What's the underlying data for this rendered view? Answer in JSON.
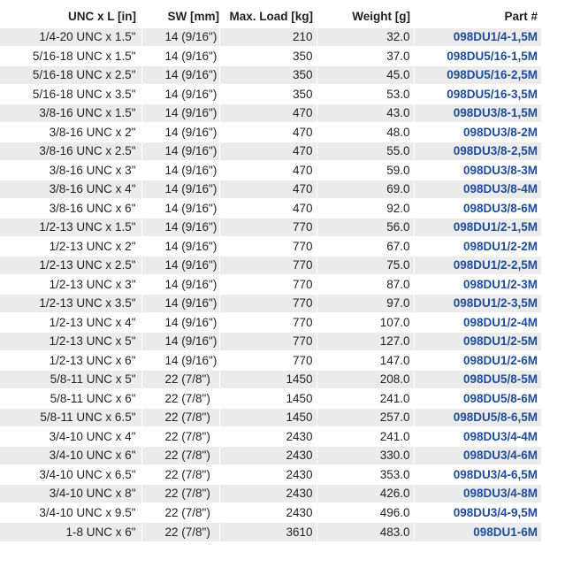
{
  "table": {
    "headers": {
      "size": "UNC x L [in]",
      "sw": "SW [mm]",
      "load": "Max. Load [kg]",
      "weight": "Weight [g]",
      "part": "Part #"
    },
    "rows": [
      {
        "size": "1/4-20 UNC x 1.5\"",
        "sw": "14 (9/16\")",
        "load": "210",
        "weight": "32.0",
        "part": "098DU1/4-1,5M"
      },
      {
        "size": "5/16-18 UNC x 1.5\"",
        "sw": "14 (9/16\")",
        "load": "350",
        "weight": "37.0",
        "part": "098DU5/16-1,5M"
      },
      {
        "size": "5/16-18 UNC x 2.5\"",
        "sw": "14 (9/16\")",
        "load": "350",
        "weight": "45.0",
        "part": "098DU5/16-2,5M"
      },
      {
        "size": "5/16-18 UNC x 3.5\"",
        "sw": "14 (9/16\")",
        "load": "350",
        "weight": "53.0",
        "part": "098DU5/16-3,5M"
      },
      {
        "size": "3/8-16 UNC x 1.5\"",
        "sw": "14 (9/16\")",
        "load": "470",
        "weight": "43.0",
        "part": "098DU3/8-1,5M"
      },
      {
        "size": "3/8-16 UNC x 2\"",
        "sw": "14 (9/16\")",
        "load": "470",
        "weight": "48.0",
        "part": "098DU3/8-2M"
      },
      {
        "size": "3/8-16 UNC x 2.5\"",
        "sw": "14 (9/16\")",
        "load": "470",
        "weight": "55.0",
        "part": "098DU3/8-2,5M"
      },
      {
        "size": "3/8-16 UNC x 3\"",
        "sw": "14 (9/16\")",
        "load": "470",
        "weight": "59.0",
        "part": "098DU3/8-3M"
      },
      {
        "size": "3/8-16 UNC x 4\"",
        "sw": "14 (9/16\")",
        "load": "470",
        "weight": "69.0",
        "part": "098DU3/8-4M"
      },
      {
        "size": "3/8-16 UNC x 6\"",
        "sw": "14 (9/16\")",
        "load": "470",
        "weight": "92.0",
        "part": "098DU3/8-6M"
      },
      {
        "size": "1/2-13 UNC x 1.5\"",
        "sw": "14 (9/16\")",
        "load": "770",
        "weight": "56.0",
        "part": "098DU1/2-1,5M"
      },
      {
        "size": "1/2-13 UNC x 2\"",
        "sw": "14 (9/16\")",
        "load": "770",
        "weight": "67.0",
        "part": "098DU1/2-2M"
      },
      {
        "size": "1/2-13 UNC x 2.5\"",
        "sw": "14 (9/16\")",
        "load": "770",
        "weight": "75.0",
        "part": "098DU1/2-2,5M"
      },
      {
        "size": "1/2-13 UNC x 3\"",
        "sw": "14 (9/16\")",
        "load": "770",
        "weight": "87.0",
        "part": "098DU1/2-3M"
      },
      {
        "size": "1/2-13 UNC x 3.5\"",
        "sw": "14 (9/16\")",
        "load": "770",
        "weight": "97.0",
        "part": "098DU1/2-3,5M"
      },
      {
        "size": "1/2-13 UNC x 4\"",
        "sw": "14 (9/16\")",
        "load": "770",
        "weight": "107.0",
        "part": "098DU1/2-4M"
      },
      {
        "size": "1/2-13 UNC x 5\"",
        "sw": "14 (9/16\")",
        "load": "770",
        "weight": "127.0",
        "part": "098DU1/2-5M"
      },
      {
        "size": "1/2-13 UNC x 6\"",
        "sw": "14 (9/16\")",
        "load": "770",
        "weight": "147.0",
        "part": "098DU1/2-6M"
      },
      {
        "size": "5/8-11 UNC x 5\"",
        "sw": "22 (7/8\")",
        "load": "1450",
        "weight": "208.0",
        "part": "098DU5/8-5M"
      },
      {
        "size": "5/8-11 UNC x 6\"",
        "sw": "22 (7/8\")",
        "load": "1450",
        "weight": "241.0",
        "part": "098DU5/8-6M"
      },
      {
        "size": "5/8-11 UNC x 6.5\"",
        "sw": "22 (7/8\")",
        "load": "1450",
        "weight": "257.0",
        "part": "098DU5/8-6,5M"
      },
      {
        "size": "3/4-10 UNC x 4\"",
        "sw": "22 (7/8\")",
        "load": "2430",
        "weight": "241.0",
        "part": "098DU3/4-4M"
      },
      {
        "size": "3/4-10 UNC x 6\"",
        "sw": "22 (7/8\")",
        "load": "2430",
        "weight": "330.0",
        "part": "098DU3/4-6M"
      },
      {
        "size": "3/4-10 UNC x 6.5\"",
        "sw": "22 (7/8\")",
        "load": "2430",
        "weight": "353.0",
        "part": "098DU3/4-6,5M"
      },
      {
        "size": "3/4-10 UNC x 8\"",
        "sw": "22 (7/8\")",
        "load": "2430",
        "weight": "426.0",
        "part": "098DU3/4-8M"
      },
      {
        "size": "3/4-10 UNC x 9.5\"",
        "sw": "22 (7/8\")",
        "load": "2430",
        "weight": "496.0",
        "part": "098DU3/4-9,5M"
      },
      {
        "size": "1-8 UNC x 6\"",
        "sw": "22 (7/8\")",
        "load": "3610",
        "weight": "483.0",
        "part": "098DU1-6M"
      }
    ]
  },
  "colors": {
    "part_number": "#1f4d9a",
    "stripe": "#ebebeb",
    "text": "#231f20"
  }
}
